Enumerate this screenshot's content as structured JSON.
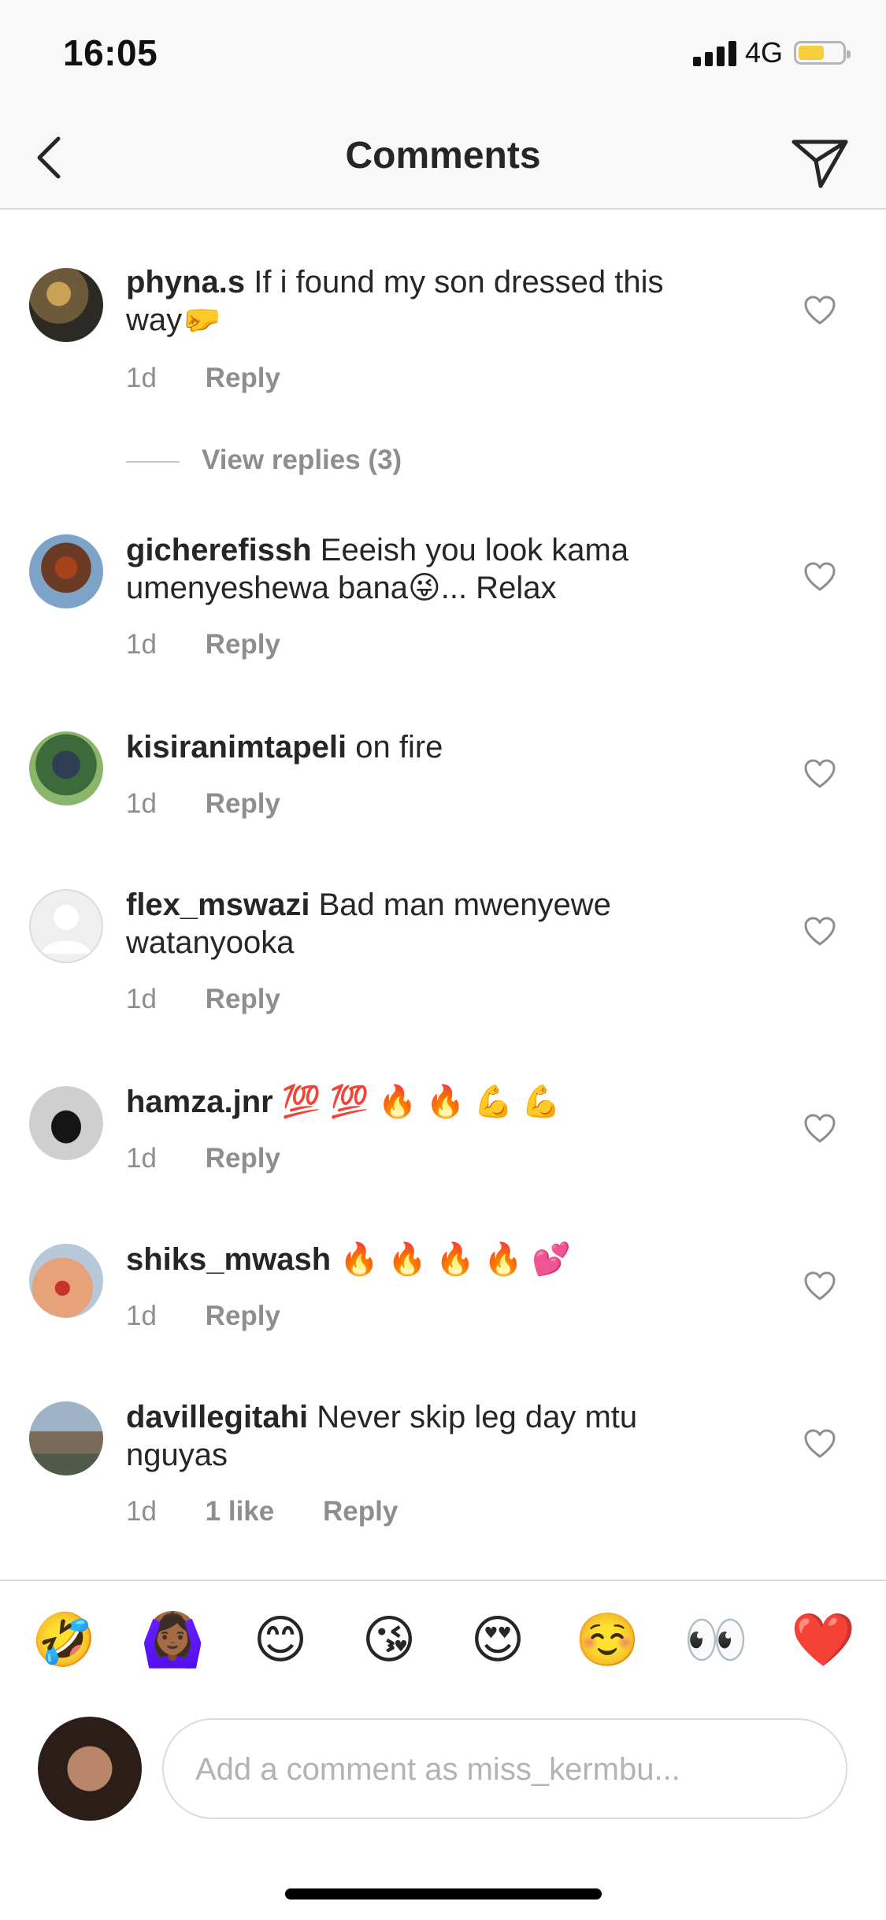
{
  "status_bar": {
    "time": "16:05",
    "network": "4G",
    "battery_color": "#f6cd3d"
  },
  "header": {
    "title": "Comments",
    "back_icon": "chevron-left-icon",
    "send_icon": "paper-plane-icon"
  },
  "comments": [
    {
      "username": "phyna.s",
      "text": "If i found my son dressed this way🤛",
      "age": "1d",
      "reply_label": "Reply"
    },
    {
      "username": "gicherefissh",
      "text": "Eeeish you look kama umenyeshewa bana😜... Relax",
      "age": "1d",
      "reply_label": "Reply"
    },
    {
      "username": "kisiranimtapeli",
      "text": "on fire",
      "age": "1d",
      "reply_label": "Reply"
    },
    {
      "username": "flex_mswazi",
      "text": "Bad man mwenyewe watanyooka",
      "age": "1d",
      "reply_label": "Reply"
    },
    {
      "username": "hamza.jnr",
      "text": "💯 💯 🔥 🔥 💪 💪",
      "age": "1d",
      "reply_label": "Reply"
    },
    {
      "username": "shiks_mwash",
      "text": "🔥 🔥 🔥 🔥 💕",
      "age": "1d",
      "reply_label": "Reply"
    },
    {
      "username": "davillegitahi",
      "text": "Never skip leg day mtu nguyas",
      "age": "1d",
      "likes": "1 like",
      "reply_label": "Reply"
    }
  ],
  "view_replies": "View replies (3)",
  "emoji_bar": [
    "🤣",
    "🙆🏾‍♀️",
    "😊",
    "😘",
    "😍",
    "☺️",
    "👀",
    "❤️"
  ],
  "composer": {
    "placeholder": "Add a comment as miss_kermbu..."
  },
  "colors": {
    "text": "#262626",
    "muted": "#8e8e8e",
    "divider": "#dbdbdb",
    "bar_bg": "#f8f8f8"
  }
}
